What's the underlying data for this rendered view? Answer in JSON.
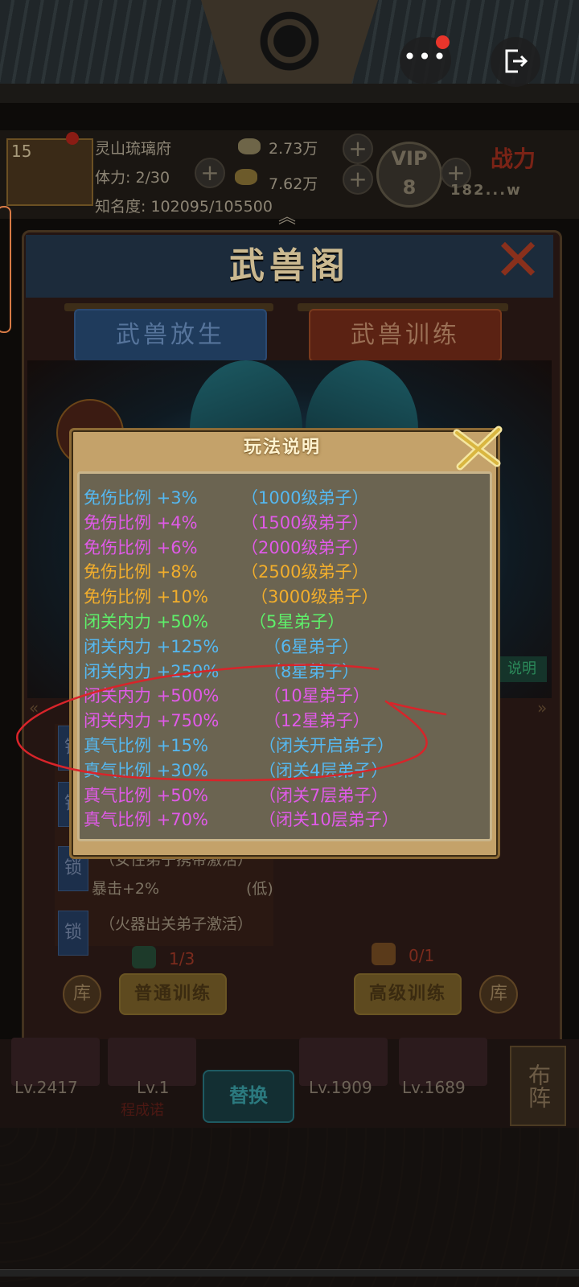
{
  "system": {
    "menu_glyph": "•••",
    "exit_glyph": "⎋"
  },
  "player": {
    "level": "15",
    "name": "灵山琉璃府",
    "stamina": "体力: 2/30",
    "fame": "知名度: 102095/105500",
    "silver": "2.73万",
    "gold": "7.62万",
    "vip": "VIP\n8",
    "power_label": "战力",
    "power_value": "182...w"
  },
  "panel": {
    "title": "武兽阁",
    "tabs": [
      "武兽放生",
      "武兽训练"
    ],
    "explain_tag": "说明",
    "locks": [
      {
        "lock": "锁",
        "line1": "",
        "line2": ""
      },
      {
        "lock": "锁",
        "line1": "",
        "line2": ""
      },
      {
        "lock": "锁",
        "line1": "（女性弟子携带激活）",
        "line2": "暴击+2%",
        "grade": "(低)"
      },
      {
        "lock": "锁",
        "line1": "（火器出关弟子激活）",
        "line2": ""
      }
    ],
    "normal_count": "1/3",
    "advanced_count": "0/1",
    "normal_train": "普通训练",
    "advanced_train": "高级训练",
    "ku_label": "库"
  },
  "heroes": [
    {
      "lv": "Lv.2417",
      "name": ""
    },
    {
      "lv": "Lv.1",
      "name": "程成诺"
    },
    {
      "lv": "Lv.1909",
      "name": ""
    },
    {
      "lv": "Lv.1689",
      "name": ""
    }
  ],
  "swap_label": "替换",
  "formation_label": "布阵",
  "dialog": {
    "title": "玩法说明",
    "rows": [
      {
        "name": "免伤比例 +3%",
        "cond": "（1000级弟子）",
        "color": "#55b8f0"
      },
      {
        "name": "免伤比例 +4%",
        "cond": "（1500级弟子）",
        "color": "#e05ae8"
      },
      {
        "name": "免伤比例 +6%",
        "cond": "（2000级弟子）",
        "color": "#e05ae8"
      },
      {
        "name": "免伤比例 +8%",
        "cond": "（2500级弟子）",
        "color": "#f2ae2c"
      },
      {
        "name": "免伤比例 +10%",
        "cond": "（3000级弟子）",
        "color": "#f2ae2c"
      },
      {
        "name": "闭关内力 +50%",
        "cond": "（5星弟子）",
        "color": "#5ef06a"
      },
      {
        "name": "闭关内力 +125%",
        "cond": "（6星弟子）",
        "color": "#55b8f0"
      },
      {
        "name": "闭关内力 +250%",
        "cond": "（8星弟子）",
        "color": "#55b8f0"
      },
      {
        "name": "闭关内力 +500%",
        "cond": "（10星弟子）",
        "color": "#e05ae8"
      },
      {
        "name": "闭关内力 +750%",
        "cond": "（12星弟子）",
        "color": "#e05ae8"
      },
      {
        "name": "真气比例 +15%",
        "cond": "（闭关开启弟子）",
        "color": "#55b8f0"
      },
      {
        "name": "真气比例 +30%",
        "cond": "（闭关4层弟子）",
        "color": "#55b8f0"
      },
      {
        "name": "真气比例 +50%",
        "cond": "（闭关7层弟子）",
        "color": "#e05ae8"
      },
      {
        "name": "真气比例 +70%",
        "cond": "（闭关10层弟子）",
        "color": "#e05ae8"
      }
    ]
  }
}
